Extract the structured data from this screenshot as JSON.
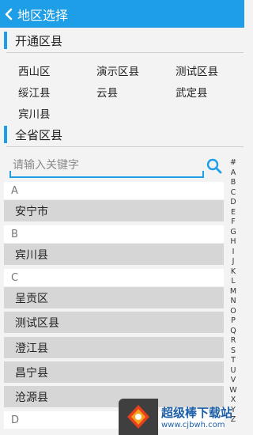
{
  "header": {
    "title": "地区选择"
  },
  "open_section": {
    "label": "开通区县",
    "cities": [
      "西山区",
      "演示区县",
      "测试区县",
      "绥江县",
      "云县",
      "武定县",
      "宾川县"
    ]
  },
  "all_section": {
    "label": "全省区县"
  },
  "search": {
    "placeholder": "请输入关键字",
    "value": ""
  },
  "groups": [
    {
      "letter": "A",
      "cities": [
        "安宁市"
      ]
    },
    {
      "letter": "B",
      "cities": [
        "宾川县"
      ]
    },
    {
      "letter": "C",
      "cities": [
        "呈贡区",
        "测试区县",
        "澄江县",
        "昌宁县",
        "沧源县"
      ]
    },
    {
      "letter": "D",
      "cities": []
    }
  ],
  "index_letters": [
    "#",
    "A",
    "B",
    "C",
    "D",
    "E",
    "F",
    "G",
    "H",
    "I",
    "J",
    "K",
    "L",
    "M",
    "N",
    "O",
    "P",
    "Q",
    "R",
    "S",
    "T",
    "U",
    "V",
    "W",
    "X",
    "Y",
    "Z"
  ],
  "watermark": {
    "name": "超级棒下载站",
    "url": "www.cjbwh.com"
  },
  "colors": {
    "accent": "#1e9ee6",
    "row_bg": "#d6d6d6",
    "page_bg": "#f3f3f3"
  }
}
